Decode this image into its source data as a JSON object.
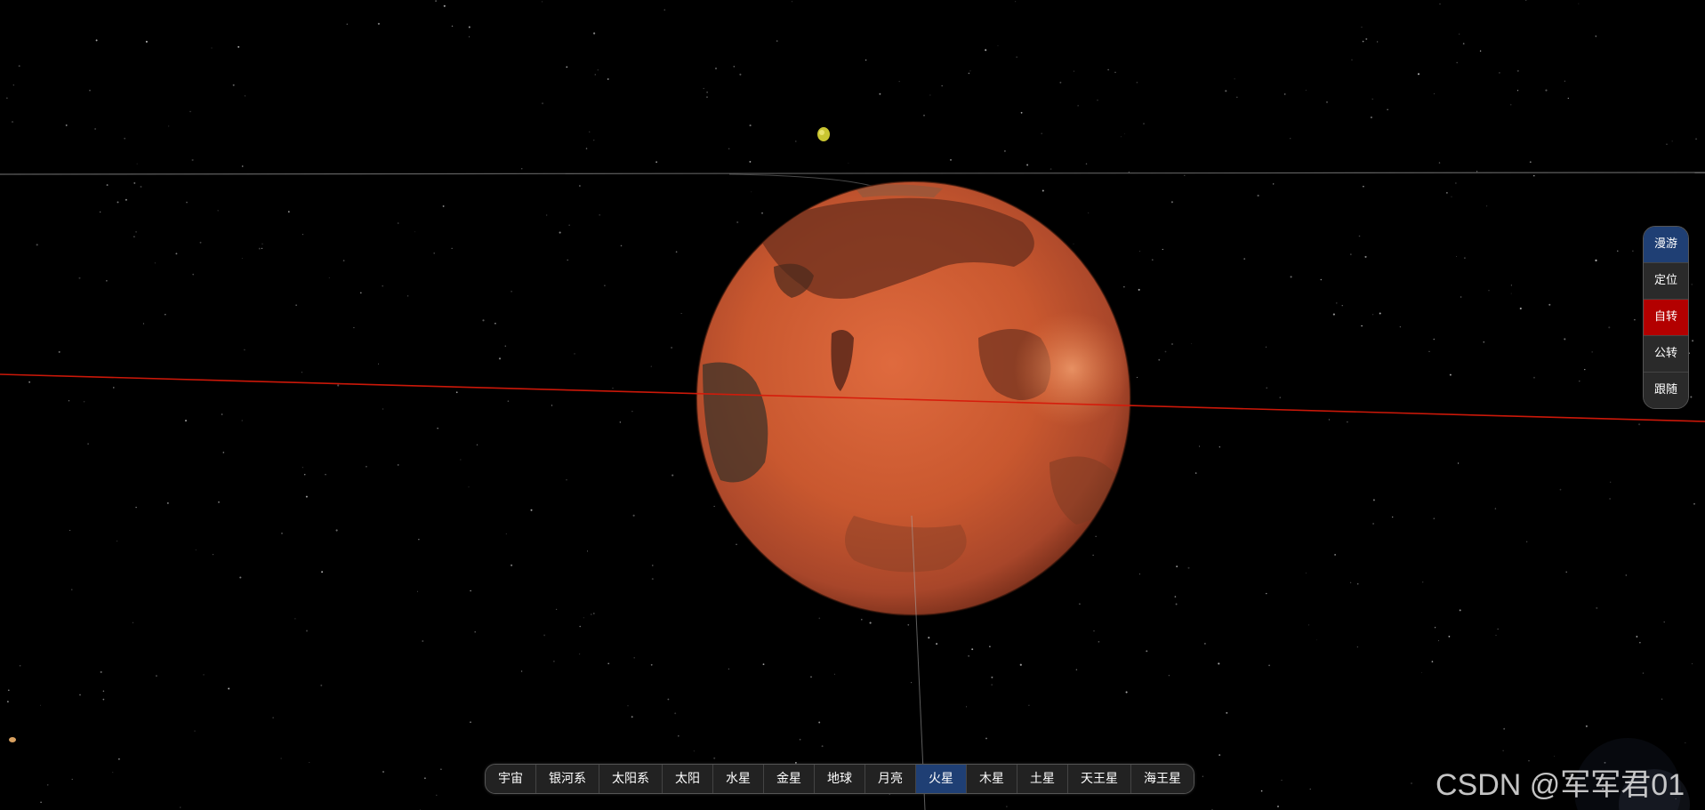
{
  "colors": {
    "background": "#000000",
    "mars_base": "#c9582f",
    "mars_dark": "#5c2c1e",
    "orbit_red": "#d61a0a",
    "nav_active": "#1f3f74",
    "side_active_red": "#b30000"
  },
  "bottom_nav": {
    "items": [
      {
        "label": "宇宙",
        "active": false
      },
      {
        "label": "银河系",
        "active": false
      },
      {
        "label": "太阳系",
        "active": false
      },
      {
        "label": "太阳",
        "active": false
      },
      {
        "label": "水星",
        "active": false
      },
      {
        "label": "金星",
        "active": false
      },
      {
        "label": "地球",
        "active": false
      },
      {
        "label": "月亮",
        "active": false
      },
      {
        "label": "火星",
        "active": true
      },
      {
        "label": "木星",
        "active": false
      },
      {
        "label": "土星",
        "active": false
      },
      {
        "label": "天王星",
        "active": false
      },
      {
        "label": "海王星",
        "active": false
      }
    ]
  },
  "side_nav": {
    "items": [
      {
        "label": "漫游"
      },
      {
        "label": "定位"
      },
      {
        "label": "自转"
      },
      {
        "label": "公转"
      },
      {
        "label": "跟随"
      }
    ]
  },
  "watermark": {
    "text": "CSDN @军军君01"
  }
}
